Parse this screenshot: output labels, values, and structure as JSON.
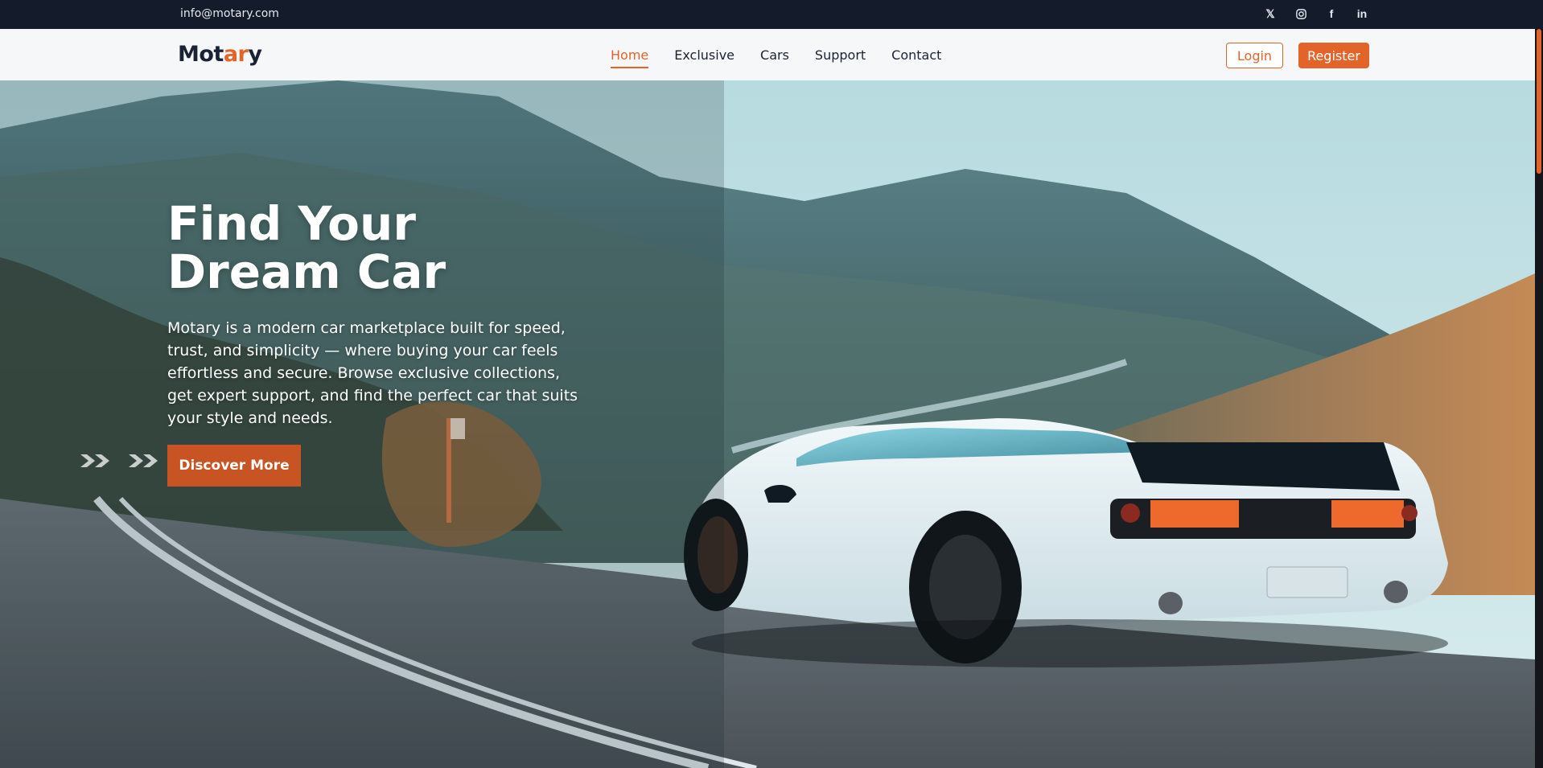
{
  "topbar": {
    "email": "info@motary.com",
    "socials": [
      {
        "icon": "x-twitter-icon",
        "glyph": "𝕏"
      },
      {
        "icon": "instagram-icon"
      },
      {
        "icon": "facebook-icon",
        "glyph": "f"
      },
      {
        "icon": "linkedin-icon",
        "glyph": "in"
      }
    ]
  },
  "navbar": {
    "logo_main": "Mot",
    "logo_accent": "ar",
    "logo_tail": "y",
    "links": [
      {
        "label": "Home",
        "active": true
      },
      {
        "label": "Exclusive",
        "active": false
      },
      {
        "label": "Cars",
        "active": false
      },
      {
        "label": "Support",
        "active": false
      },
      {
        "label": "Contact",
        "active": false
      }
    ],
    "login_label": "Login",
    "register_label": "Register"
  },
  "hero": {
    "title": "Find Your Dream Car",
    "description": "Motary is a modern car marketplace built for speed, trust, and simplicity — where buying your car feels effortless and secure. Browse exclusive collections, get expert support, and find the perfect car that suits your style and needs.",
    "cta_label": "Discover More"
  },
  "colors": {
    "accent": "#e2642b",
    "topbar_bg": "#141b2b",
    "navbar_bg": "#f6f7f9"
  }
}
